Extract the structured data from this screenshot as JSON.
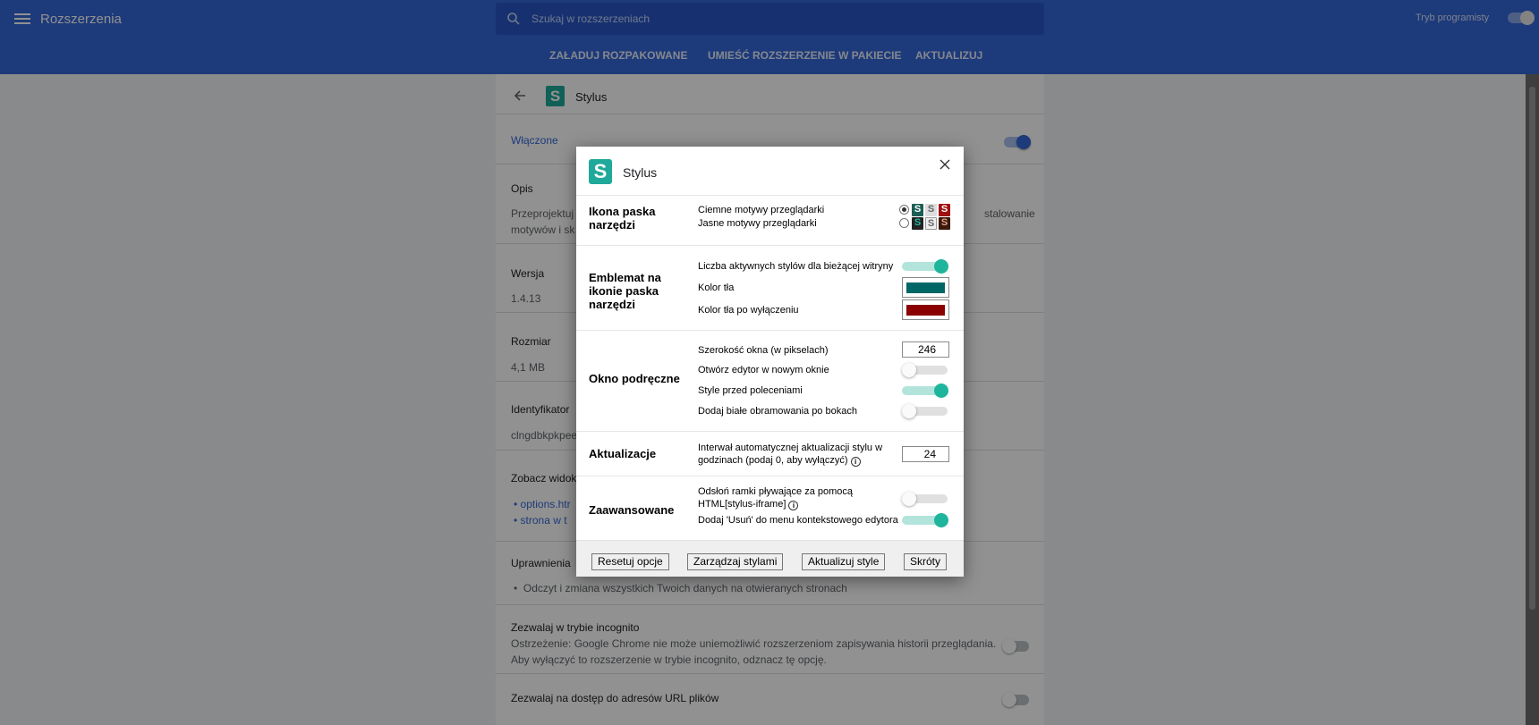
{
  "topbar": {
    "title": "Rozszerzenia",
    "search_placeholder": "Szukaj w rozszerzeniach",
    "dev_mode_label": "Tryb programisty",
    "actions": [
      "ZAŁADUJ ROZPAKOWANE",
      "UMIEŚĆ ROZSZERZENIE W PAKIECIE",
      "AKTUALIZUJ"
    ]
  },
  "details": {
    "name": "Stylus",
    "enabled_label": "Włączone",
    "description_label": "Opis",
    "description_line1": "Przeprojektuj",
    "description_line1_end": "stalowanie",
    "description_line2": "motywów i sk",
    "version_label": "Wersja",
    "version": "1.4.13",
    "size_label": "Rozmiar",
    "size": "4,1 MB",
    "id_label": "Identyfikator",
    "id": "clngdbkpkpee",
    "views_label": "Zobacz widok",
    "views": [
      "options.htr",
      "strona w t"
    ],
    "permissions_label": "Uprawnienia",
    "permission": "Odczyt i zmiana wszystkich Twoich danych na otwieranych stronach",
    "incognito_label": "Zezwalaj w trybie incognito",
    "incognito_warning1": "Ostrzeżenie: Google Chrome nie może uniemożliwić rozszerzeniom zapisywania historii przeglądania.",
    "incognito_warning2": "Aby wyłączyć to rozszerzenie w trybie incognito, odznacz tę opcję.",
    "file_urls_label": "Zezwalaj na dostęp do adresów URL plików"
  },
  "dialog": {
    "title": "Stylus",
    "logo_letter": "S",
    "toolbar_icon": {
      "title": "Ikona paska narzędzi",
      "dark": "Ciemne motywy przeglądarki",
      "light": "Jasne motywy przeglądarki",
      "selected": "dark"
    },
    "badge": {
      "title": "Emblemat na ikonie paska narzędzi",
      "count_label": "Liczba aktywnych stylów dla bieżącej witryny",
      "count_on": true,
      "bg_label": "Kolor tła",
      "bg_color": "#006666",
      "disabled_bg_label": "Kolor tła po wyłączeniu",
      "disabled_bg_color": "#8b0000"
    },
    "popup": {
      "title": "Okno podręczne",
      "width_label": "Szerokość okna (w pikselach)",
      "width_value": "246",
      "new_window_label": "Otwórz edytor w nowym oknie",
      "new_window_on": false,
      "styles_first_label": "Style przed poleceniami",
      "styles_first_on": true,
      "borders_label": "Dodaj białe obramowania po bokach",
      "borders_on": false
    },
    "updates": {
      "title": "Aktualizacje",
      "interval_label": "Interwał automatycznej aktualizacji stylu w godzinach (podaj 0, aby wyłączyć)",
      "interval_value": "24"
    },
    "advanced": {
      "title": "Zaawansowane",
      "iframe_label": "Odsłoń ramki pływające za pomocą HTML[stylus-iframe]",
      "iframe_on": false,
      "delete_label": "Dodaj 'Usuń' do menu kontekstowego edytora",
      "delete_on": true
    },
    "buttons": {
      "reset": "Resetuj opcje",
      "manage": "Zarządzaj stylami",
      "update": "Aktualizuj style",
      "shortcuts": "Skróty"
    }
  },
  "colors": {
    "topbar": "#3367d6",
    "accent": "#1fb59c"
  }
}
